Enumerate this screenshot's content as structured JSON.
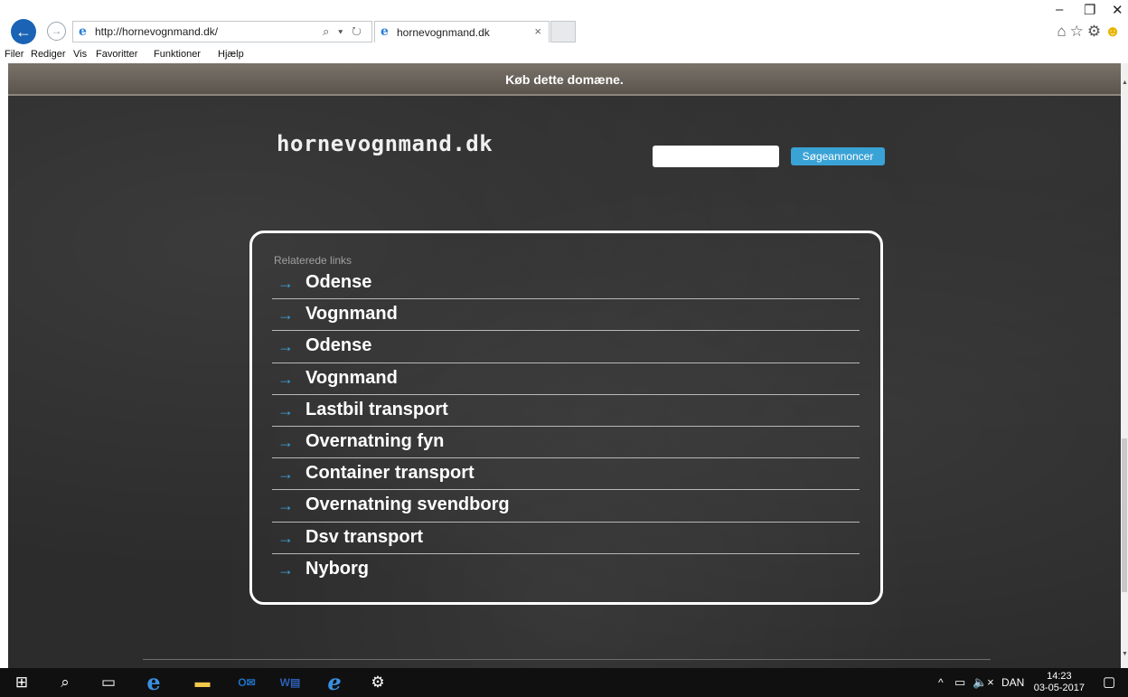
{
  "browser": {
    "url": "http://hornevognmand.dk/",
    "tab_title": "hornevognmand.dk",
    "tab_close": "×",
    "addr_tools": "⌕ ▾ ↻",
    "window_controls": {
      "minimize": "–",
      "restore": "❐",
      "close": "✕"
    },
    "toolbar_icons": [
      "home-icon",
      "star-icon",
      "gear-icon",
      "smiley-icon"
    ],
    "menu": [
      "Filer",
      "Rediger",
      "Vis",
      "Favoritter",
      "Funktioner",
      "Hjælp"
    ]
  },
  "page": {
    "buy_banner": "Køb dette domæne.",
    "logo": "hornevognmand.dk",
    "search": {
      "placeholder": "",
      "button_label": "Søgeannoncer"
    },
    "related": {
      "heading": "Relaterede links",
      "arrow": "→",
      "links": [
        "Odense",
        "Vognmand",
        "Odense",
        "Vognmand",
        "Lastbil transport",
        "Overnatning fyn",
        "Container transport",
        "Overnatning svendborg",
        "Dsv transport",
        "Nyborg"
      ]
    },
    "colors": {
      "accent": "#3aa3d6",
      "banner": "#6b645c",
      "background": "#2c2c2c"
    }
  },
  "taskbar": {
    "tray_chevron": "^",
    "language": "DAN",
    "time": "14:23",
    "date": "03-05-2017"
  }
}
